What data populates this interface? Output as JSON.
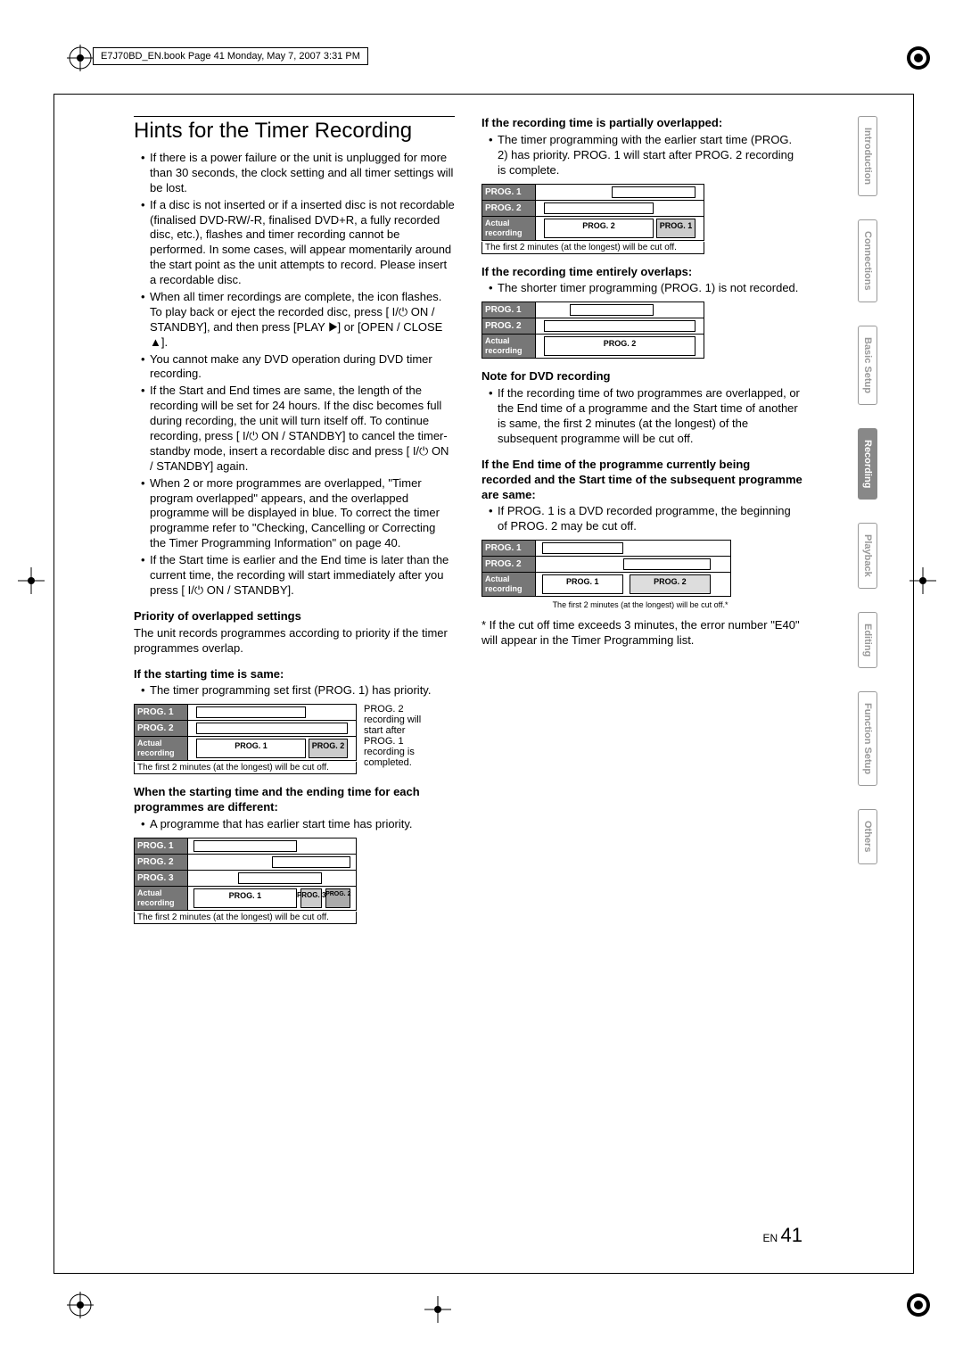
{
  "header_tag": "E7J70BD_EN.book  Page 41  Monday, May 7, 2007  3:31 PM",
  "title": "Hints for the Timer Recording",
  "left_bullets": [
    "If there is a power failure or the unit is unplugged for more than 30 seconds, the clock setting and all timer settings will be lost.",
    "If a disc is not inserted or if a inserted disc is not recordable (finalised DVD-RW/-R, finalised DVD+R, a fully recorded disc, etc.),  flashes and timer recording cannot be performed. In some cases,  will appear momentarily around the start point as the unit attempts to record. Please insert a recordable disc.",
    "When all timer recordings are complete, the  icon flashes. To play back or eject the recorded disc, press [ I/⏻ ON / STANDBY], and then press [PLAY ▶] or [OPEN / CLOSE ▲].",
    "You cannot make any DVD operation during DVD timer recording.",
    "If the Start and End times are same, the length of the recording will be set for 24 hours. If the disc becomes full during recording, the unit will turn itself off. To continue recording, press [ I/⏻ ON / STANDBY] to cancel the timer-standby mode, insert a recordable disc and press [ I/⏻ ON / STANDBY] again.",
    "When 2 or more programmes are overlapped, \"Timer program overlapped\" appears, and the overlapped programme will be displayed in blue. To correct the timer programme refer to \"Checking, Cancelling or Correcting the Timer Programming Information\" on page 40.",
    "If the Start time is earlier and the End time is later than the current time, the recording will start immediately after you press [ I/⏻ ON / STANDBY]."
  ],
  "priority_heading": "Priority of overlapped settings",
  "priority_text": "The unit records programmes according to priority if the timer programmes overlap.",
  "if_start_same": "If the starting time is same:",
  "if_start_same_txt": "The timer programming set first (PROG. 1) has priority.",
  "diagram_labels": {
    "prog1": "PROG. 1",
    "prog2": "PROG. 2",
    "prog3": "PROG. 3",
    "actual": "Actual recording"
  },
  "diag1_side": "PROG. 2 recording will start after PROG. 1 recording is completed.",
  "caption_2min": "The first 2 minutes (at the longest) will be cut off.",
  "diff_start_end": "When the starting time and the ending time for each programmes are different:",
  "diff_start_end_txt": "A programme that has earlier start time has priority.",
  "partial_overlap": "If the recording time is partially overlapped:",
  "partial_overlap_txt": "The timer programming with the earlier start time (PROG. 2) has priority. PROG. 1 will start after PROG. 2 recording is complete.",
  "entire_overlap": "If the recording time entirely overlaps:",
  "entire_overlap_txt": "The shorter timer programming (PROG. 1) is not recorded.",
  "note_dvd_head": "Note for DVD recording",
  "note_dvd_txt": "If the recording time of two programmes are overlapped, or the End time of a programme and the Start time of another is same, the first 2 minutes (at the longest) of the subsequent programme will be cut off.",
  "end_same_head": "If the End time of the programme currently being recorded and the Start time of the subsequent programme are same:",
  "end_same_txt": "If PROG. 1 is a DVD recorded programme, the beginning of PROG. 2 may be cut off.",
  "diag5_note": "The first 2 minutes (at the longest) will be cut off.*",
  "foot_star": "* If the cut off time exceeds 3 minutes, the error number \"E40\" will appear in the Timer Programming list.",
  "tabs": [
    "Introduction",
    "Connections",
    "Basic Setup",
    "Recording",
    "Playback",
    "Editing",
    "Function Setup",
    "Others"
  ],
  "active_tab_index": 3,
  "page_lang": "EN",
  "page_num": "41"
}
